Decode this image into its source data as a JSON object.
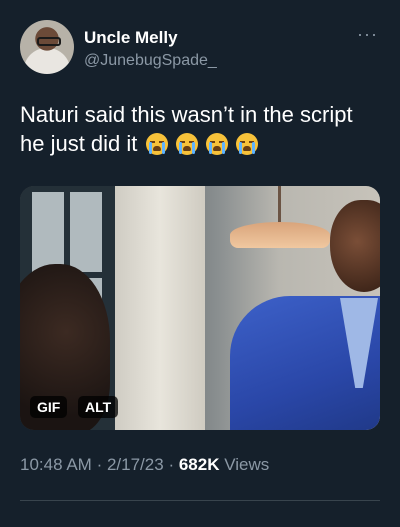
{
  "tweet": {
    "author_name": "Uncle Melly",
    "author_handle": "@JunebugSpade_",
    "more_label": "···",
    "text": "Naturi said this wasn’t in the script he just did it",
    "emoji_count": 4,
    "emoji_name": "loudly-crying-face",
    "media": {
      "gif_badge": "GIF",
      "alt_badge": "ALT"
    },
    "time": "10:48 AM",
    "separator": "·",
    "date": "2/17/23",
    "views_count": "682K",
    "views_label": "Views"
  },
  "colors": {
    "background": "#15202b",
    "secondary_text": "#8b98a5",
    "primary_text": "#ffffff"
  }
}
